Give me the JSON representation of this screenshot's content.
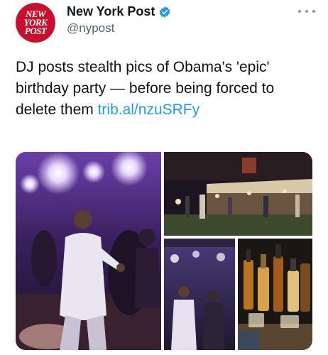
{
  "account": {
    "logo_lines": [
      "NEW",
      "YORK",
      "POST"
    ],
    "name": "New York Post",
    "handle": "@nypost",
    "verified": true
  },
  "tweet": {
    "text": "DJ posts stealth pics of Obama's 'epic' birthday party — before being forced to delete them ",
    "link": "trib.al/nzuSRFy"
  },
  "media": {
    "photos": [
      {
        "name": "performer-on-stage-photo"
      },
      {
        "name": "outdoor-party-tent-photo"
      },
      {
        "name": "dance-floor-screenshot-photo"
      },
      {
        "name": "liquor-bottles-bar-photo"
      }
    ]
  },
  "colors": {
    "brand_red": "#c8102e",
    "link_blue": "#1d9bf0",
    "secondary_text": "#536471"
  }
}
